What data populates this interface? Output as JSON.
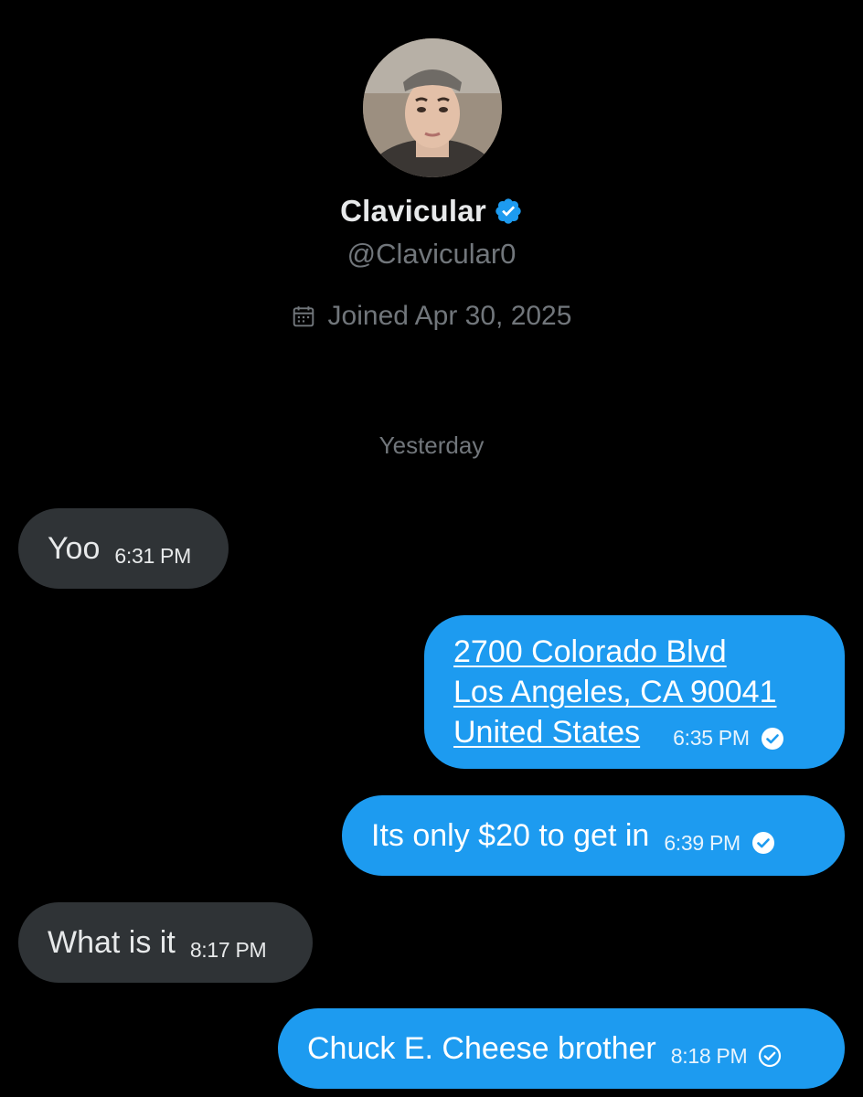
{
  "profile": {
    "display_name": "Clavicular",
    "handle": "@Clavicular0",
    "joined": "Joined Apr 30, 2025",
    "verified_color": "#1d9bf0"
  },
  "date_separator": "Yesterday",
  "messages": [
    {
      "direction": "incoming",
      "text": "Yoo",
      "time": "6:31 PM"
    },
    {
      "direction": "outgoing",
      "address_lines": [
        "2700 Colorado Blvd",
        "Los Angeles, CA  90041",
        "United States"
      ],
      "time": "6:35 PM",
      "status": "sent"
    },
    {
      "direction": "outgoing",
      "text": "Its only $20 to get in",
      "time": "6:39 PM",
      "status": "sent"
    },
    {
      "direction": "incoming",
      "text": "What is it",
      "time": "8:17 PM"
    },
    {
      "direction": "outgoing",
      "text": "Chuck E. Cheese brother",
      "time": "8:18 PM",
      "status": "sent-outline"
    }
  ],
  "colors": {
    "background": "#000000",
    "incoming_bubble": "#2f3336",
    "outgoing_bubble": "#1d9bf0",
    "muted_text": "#71767b"
  },
  "icons": {
    "verified": "verified-badge-icon",
    "calendar": "calendar-icon",
    "sent": "check-circle-icon"
  }
}
